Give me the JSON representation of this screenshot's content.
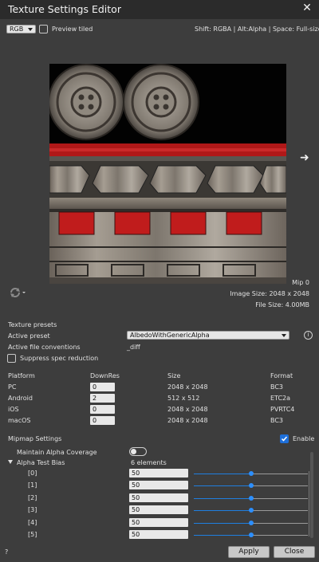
{
  "window": {
    "title": "Texture Settings Editor",
    "close_icon": "close-icon"
  },
  "toolbar": {
    "channel_select": "RGB",
    "preview_tiled_label": "Preview tiled",
    "preview_tiled_checked": false,
    "shortcut_hint": "Shift: RGBA | Alt:Alpha | Space: Full-size"
  },
  "preview": {
    "next_icon": "arrow-right-icon",
    "refresh_icon": "refresh-icon",
    "mip_label": "Mip 0",
    "image_size_label": "Image Size: 2048 x 2048",
    "file_size_label": "File Size: 4.00MB"
  },
  "presets": {
    "section_label": "Texture presets",
    "active_preset_label": "Active preset",
    "active_preset_value": "AlbedoWithGenericAlpha",
    "conventions_label": "Active file conventions",
    "conventions_value": "_diff",
    "suppress_label": "Suppress spec reduction",
    "suppress_checked": false
  },
  "platforms": {
    "headers": {
      "platform": "Platform",
      "downres": "DownRes",
      "size": "Size",
      "format": "Format"
    },
    "rows": [
      {
        "platform": "PC",
        "downres": "0",
        "size": "2048 x 2048",
        "format": "BC3"
      },
      {
        "platform": "Android",
        "downres": "2",
        "size": "512 x 512",
        "format": "ETC2a"
      },
      {
        "platform": "iOS",
        "downres": "0",
        "size": "2048 x 2048",
        "format": "PVRTC4"
      },
      {
        "platform": "macOS",
        "downres": "0",
        "size": "2048 x 2048",
        "format": "BC3"
      }
    ]
  },
  "mipmap": {
    "section_label": "Mipmap Settings",
    "enable_label": "Enable",
    "enable_checked": true,
    "maintain_alpha_label": "Maintain Alpha Coverage",
    "maintain_alpha_on": false,
    "alpha_bias_label": "Alpha Test Bias",
    "alpha_bias_count": "6 elements",
    "bias_rows": [
      {
        "index": "[0]",
        "value": "50",
        "fraction": 0.5
      },
      {
        "index": "[1]",
        "value": "50",
        "fraction": 0.5
      },
      {
        "index": "[2]",
        "value": "50",
        "fraction": 0.5
      },
      {
        "index": "[3]",
        "value": "50",
        "fraction": 0.5
      },
      {
        "index": "[4]",
        "value": "50",
        "fraction": 0.5
      },
      {
        "index": "[5]",
        "value": "50",
        "fraction": 0.5
      }
    ]
  },
  "footer": {
    "help_label": "?",
    "apply_label": "Apply",
    "close_label": "Close"
  },
  "colors": {
    "accent": "#1e6fd9",
    "background": "#3d3d3d",
    "titlebar": "#2b2b2b"
  }
}
